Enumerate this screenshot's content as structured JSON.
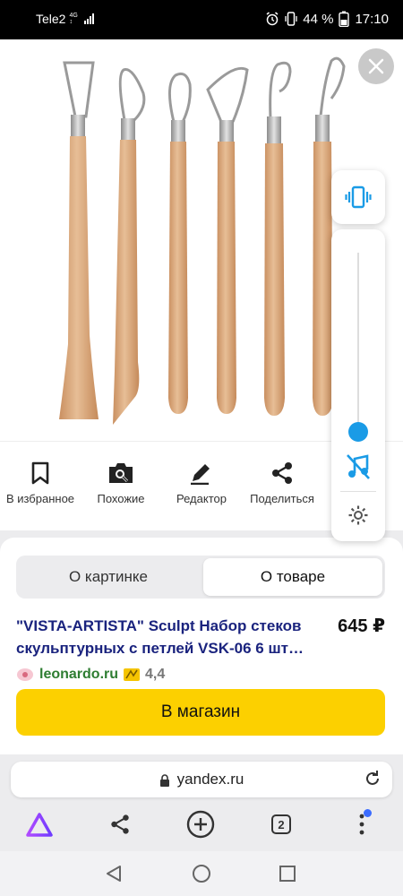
{
  "status_bar": {
    "carrier": "Tele2",
    "network": "4G",
    "battery": "44 %",
    "time": "17:10"
  },
  "image": {
    "close_icon": "close-icon",
    "tools_count": 6,
    "handle_color": "#dcae84",
    "loop_color": "#9a9a9a"
  },
  "volume_panel": {
    "vibrate_icon": "vibrate-icon",
    "music_off_icon": "music-off-icon",
    "settings_icon": "gear-icon",
    "accent": "#1a9be6"
  },
  "actions": [
    {
      "label": "В избранное",
      "icon": "bookmark-icon"
    },
    {
      "label": "Похожие",
      "icon": "camera-search-icon"
    },
    {
      "label": "Редактор",
      "icon": "pencil-icon"
    },
    {
      "label": "Поделиться",
      "icon": "share-icon"
    }
  ],
  "tabs": {
    "about_image": "О картинке",
    "about_product": "О товаре",
    "active": "about_product"
  },
  "product": {
    "title": "\"VISTA-ARTISTA\" Sculpt Набор стеков скульптурных с петлей VSK-06 6 шт…",
    "price": "645 ₽",
    "seller": "leonardo.ru",
    "rating": "4,4",
    "shop_button": "В магазин",
    "button_color": "#fcd000"
  },
  "url_bar": {
    "url": "yandex.ru"
  },
  "browser_nav": {
    "tabs_count": "2"
  }
}
